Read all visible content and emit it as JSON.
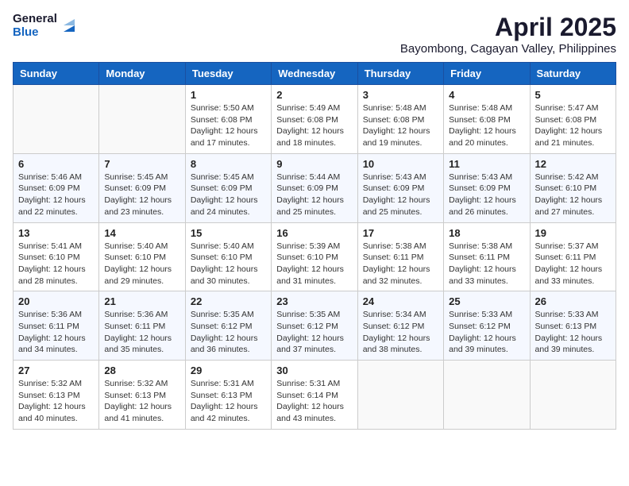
{
  "header": {
    "logo_general": "General",
    "logo_blue": "Blue",
    "month_title": "April 2025",
    "subtitle": "Bayombong, Cagayan Valley, Philippines"
  },
  "weekdays": [
    "Sunday",
    "Monday",
    "Tuesday",
    "Wednesday",
    "Thursday",
    "Friday",
    "Saturday"
  ],
  "weeks": [
    [
      {
        "day": "",
        "info": ""
      },
      {
        "day": "",
        "info": ""
      },
      {
        "day": "1",
        "info": "Sunrise: 5:50 AM\nSunset: 6:08 PM\nDaylight: 12 hours and 17 minutes."
      },
      {
        "day": "2",
        "info": "Sunrise: 5:49 AM\nSunset: 6:08 PM\nDaylight: 12 hours and 18 minutes."
      },
      {
        "day": "3",
        "info": "Sunrise: 5:48 AM\nSunset: 6:08 PM\nDaylight: 12 hours and 19 minutes."
      },
      {
        "day": "4",
        "info": "Sunrise: 5:48 AM\nSunset: 6:08 PM\nDaylight: 12 hours and 20 minutes."
      },
      {
        "day": "5",
        "info": "Sunrise: 5:47 AM\nSunset: 6:08 PM\nDaylight: 12 hours and 21 minutes."
      }
    ],
    [
      {
        "day": "6",
        "info": "Sunrise: 5:46 AM\nSunset: 6:09 PM\nDaylight: 12 hours and 22 minutes."
      },
      {
        "day": "7",
        "info": "Sunrise: 5:45 AM\nSunset: 6:09 PM\nDaylight: 12 hours and 23 minutes."
      },
      {
        "day": "8",
        "info": "Sunrise: 5:45 AM\nSunset: 6:09 PM\nDaylight: 12 hours and 24 minutes."
      },
      {
        "day": "9",
        "info": "Sunrise: 5:44 AM\nSunset: 6:09 PM\nDaylight: 12 hours and 25 minutes."
      },
      {
        "day": "10",
        "info": "Sunrise: 5:43 AM\nSunset: 6:09 PM\nDaylight: 12 hours and 25 minutes."
      },
      {
        "day": "11",
        "info": "Sunrise: 5:43 AM\nSunset: 6:09 PM\nDaylight: 12 hours and 26 minutes."
      },
      {
        "day": "12",
        "info": "Sunrise: 5:42 AM\nSunset: 6:10 PM\nDaylight: 12 hours and 27 minutes."
      }
    ],
    [
      {
        "day": "13",
        "info": "Sunrise: 5:41 AM\nSunset: 6:10 PM\nDaylight: 12 hours and 28 minutes."
      },
      {
        "day": "14",
        "info": "Sunrise: 5:40 AM\nSunset: 6:10 PM\nDaylight: 12 hours and 29 minutes."
      },
      {
        "day": "15",
        "info": "Sunrise: 5:40 AM\nSunset: 6:10 PM\nDaylight: 12 hours and 30 minutes."
      },
      {
        "day": "16",
        "info": "Sunrise: 5:39 AM\nSunset: 6:10 PM\nDaylight: 12 hours and 31 minutes."
      },
      {
        "day": "17",
        "info": "Sunrise: 5:38 AM\nSunset: 6:11 PM\nDaylight: 12 hours and 32 minutes."
      },
      {
        "day": "18",
        "info": "Sunrise: 5:38 AM\nSunset: 6:11 PM\nDaylight: 12 hours and 33 minutes."
      },
      {
        "day": "19",
        "info": "Sunrise: 5:37 AM\nSunset: 6:11 PM\nDaylight: 12 hours and 33 minutes."
      }
    ],
    [
      {
        "day": "20",
        "info": "Sunrise: 5:36 AM\nSunset: 6:11 PM\nDaylight: 12 hours and 34 minutes."
      },
      {
        "day": "21",
        "info": "Sunrise: 5:36 AM\nSunset: 6:11 PM\nDaylight: 12 hours and 35 minutes."
      },
      {
        "day": "22",
        "info": "Sunrise: 5:35 AM\nSunset: 6:12 PM\nDaylight: 12 hours and 36 minutes."
      },
      {
        "day": "23",
        "info": "Sunrise: 5:35 AM\nSunset: 6:12 PM\nDaylight: 12 hours and 37 minutes."
      },
      {
        "day": "24",
        "info": "Sunrise: 5:34 AM\nSunset: 6:12 PM\nDaylight: 12 hours and 38 minutes."
      },
      {
        "day": "25",
        "info": "Sunrise: 5:33 AM\nSunset: 6:12 PM\nDaylight: 12 hours and 39 minutes."
      },
      {
        "day": "26",
        "info": "Sunrise: 5:33 AM\nSunset: 6:13 PM\nDaylight: 12 hours and 39 minutes."
      }
    ],
    [
      {
        "day": "27",
        "info": "Sunrise: 5:32 AM\nSunset: 6:13 PM\nDaylight: 12 hours and 40 minutes."
      },
      {
        "day": "28",
        "info": "Sunrise: 5:32 AM\nSunset: 6:13 PM\nDaylight: 12 hours and 41 minutes."
      },
      {
        "day": "29",
        "info": "Sunrise: 5:31 AM\nSunset: 6:13 PM\nDaylight: 12 hours and 42 minutes."
      },
      {
        "day": "30",
        "info": "Sunrise: 5:31 AM\nSunset: 6:14 PM\nDaylight: 12 hours and 43 minutes."
      },
      {
        "day": "",
        "info": ""
      },
      {
        "day": "",
        "info": ""
      },
      {
        "day": "",
        "info": ""
      }
    ]
  ]
}
